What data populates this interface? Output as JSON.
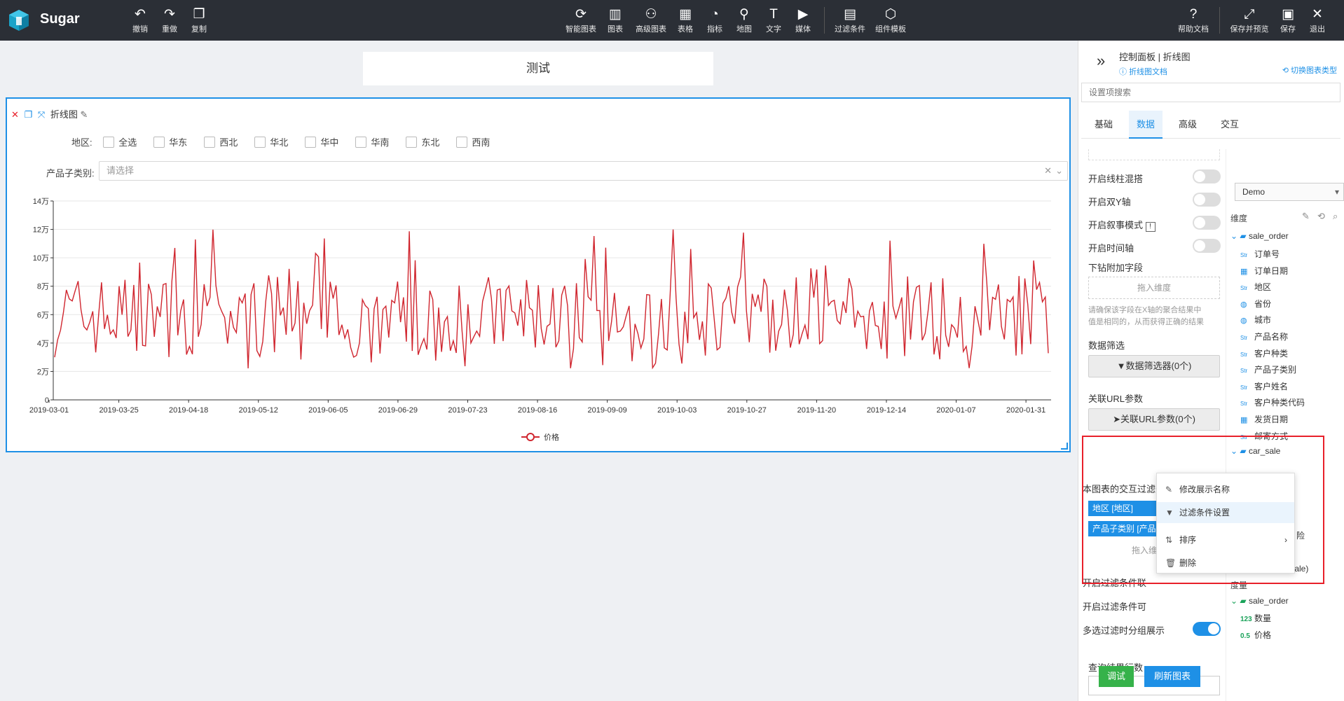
{
  "app": {
    "title": "Sugar"
  },
  "toolbar": {
    "left": [
      "撤销",
      "重做",
      "复制"
    ],
    "center": [
      "智能图表",
      "图表",
      "高级图表",
      "表格",
      "指标",
      "地图",
      "文字",
      "媒体",
      "过滤条件",
      "组件模板"
    ],
    "right": [
      "帮助文档",
      "保存并预览",
      "保存",
      "退出"
    ]
  },
  "canvas": {
    "title": "测试"
  },
  "card": {
    "name": "折线图",
    "region_label": "地区:",
    "regions": [
      "全选",
      "华东",
      "西北",
      "华北",
      "华中",
      "华南",
      "东北",
      "西南"
    ],
    "category_label": "产品子类别:",
    "category_placeholder": "请选择"
  },
  "chart_data": {
    "type": "line",
    "title": "",
    "xlabel": "",
    "ylabel": "",
    "ylim": [
      0,
      140000
    ],
    "y_ticks": [
      "0",
      "2万",
      "4万",
      "6万",
      "8万",
      "10万",
      "12万",
      "14万"
    ],
    "x_ticks": [
      "2019-03-01",
      "2019-03-25",
      "2019-04-18",
      "2019-05-12",
      "2019-06-05",
      "2019-06-29",
      "2019-07-23",
      "2019-08-16",
      "2019-09-09",
      "2019-10-03",
      "2019-10-27",
      "2019-11-20",
      "2019-12-14",
      "2020-01-07",
      "2020-01-31"
    ],
    "series": [
      {
        "name": "价格",
        "color": "#d0262f"
      }
    ],
    "legend": "bottom-center",
    "grid": true
  },
  "panel": {
    "title": "控制面板 | 折线图",
    "doc_link": "折线图文档",
    "switch_type": "切换图表类型",
    "search_placeholder": "设置项搜索",
    "tabs": [
      "基础",
      "数据",
      "高级",
      "交互"
    ],
    "settings": {
      "mixed": "开启线柱混搭",
      "dual_y": "开启双Y轴",
      "narrative": "开启叙事模式",
      "time_axis": "开启时间轴",
      "drill_field": "下钻附加字段",
      "drop_dim": "拖入维度",
      "drill_hint1": "请确保该字段在X轴的聚合结果中",
      "drill_hint2": "值是相同的，从而获得正确的结果",
      "data_filter": "数据筛选",
      "data_filter_btn": "数据筛选器(0个)",
      "url_param": "关联URL参数",
      "url_param_btn": "关联URL参数(0个)",
      "interaction_filter": "本图表的交互过滤条件",
      "chip_region": "地区 [地区]",
      "chip_category": "产品子类别 [产品",
      "drop_dim2": "拖入维",
      "filter_link": "开启过滤条件联",
      "filter_visible": "开启过滤条件可",
      "multi_group": "多选过滤时分组展示",
      "query_rows": "查询结果行数",
      "debug_btn": "调试",
      "refresh_btn": "刷新图表"
    },
    "fields": {
      "source": "Demo",
      "dimension_label": "维度",
      "measure_label": "度量",
      "groups": [
        {
          "name": "sale_order",
          "items": [
            "订单号",
            "订单日期",
            "地区",
            "省份",
            "城市",
            "产品名称",
            "客户种类",
            "产品子类别",
            "客户姓名",
            "客户种类代码",
            "发货日期",
            "邮寄方式"
          ]
        },
        {
          "name": "car_sale",
          "items": [
            "险",
            "经销商",
            "省份(car_sale)"
          ]
        }
      ],
      "measure_group": "sale_order",
      "measures": [
        "数量",
        "价格"
      ],
      "str_tag": "Str",
      "num_tag": "123",
      "dec_tag": "0.5"
    }
  },
  "context_menu": {
    "items": [
      "修改展示名称",
      "过滤条件设置",
      "排序",
      "删除"
    ]
  }
}
